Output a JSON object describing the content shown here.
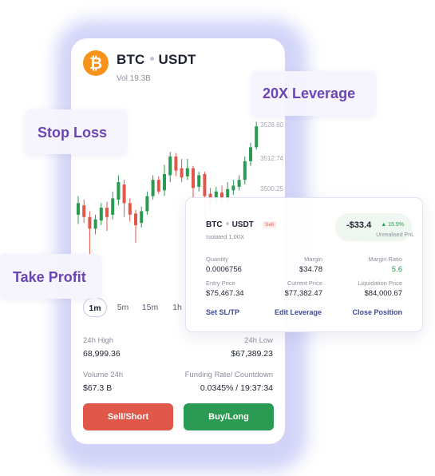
{
  "header": {
    "coin_symbol": "₿",
    "base": "BTC",
    "quote": "USDT",
    "volume": "Vol 19.3B"
  },
  "price_labels": [
    "3528.60",
    "3512.74",
    "3500.25"
  ],
  "timeframes": [
    "1m",
    "5m",
    "15m",
    "1h"
  ],
  "stats": {
    "high_label": "24h High",
    "high_value": "68,999.36",
    "low_label": "24h Low",
    "low_value": "$67,389.23",
    "volume_label": "Volume 24h",
    "volume_value": "$67.3 B",
    "funding_label": "Funding Rate/ Countdown",
    "funding_value": "0.0345% / 19:37:34"
  },
  "buttons": {
    "sell": "Sell/Short",
    "buy": "Buy/Long"
  },
  "tags": {
    "leverage": "20X Leverage",
    "stop_loss": "Stop Loss",
    "take_profit": "Take Profit"
  },
  "position": {
    "base": "BTC",
    "quote": "USDT",
    "side": "Sell",
    "mode": "Isolated 1.00X",
    "pnl": "-$33.4",
    "pnl_pct": "▲ 15.9%",
    "pnl_label": "Unrealised PnL",
    "quantity_label": "Quantity",
    "quantity_value": "0.0006756",
    "margin_label": "Margin",
    "margin_value": "$34.78",
    "margin_ratio_label": "Margin Ratio",
    "margin_ratio_value": "5.6",
    "entry_label": "Entry Price",
    "entry_value": "$75,467.34",
    "current_label": "Current Price",
    "current_value": "$77,382.47",
    "liq_label": "Liquidation Price",
    "liq_value": "$84,000.67",
    "action_sltp": "Set SL/TP",
    "action_leverage": "Edit Leverage",
    "action_close": "Close Position"
  },
  "colors": {
    "up": "#2b9a52",
    "down": "#e0584a",
    "accent": "#6b45b3",
    "coin": "#f7931a"
  },
  "chart_data": {
    "type": "candlestick",
    "y_range": [
      0,
      100
    ],
    "candles": [
      {
        "o": 42,
        "c": 52,
        "h": 58,
        "l": 34
      },
      {
        "o": 50,
        "c": 40,
        "h": 55,
        "l": 35
      },
      {
        "o": 40,
        "c": 30,
        "h": 45,
        "l": 8
      },
      {
        "o": 30,
        "c": 38,
        "h": 42,
        "l": 25
      },
      {
        "o": 37,
        "c": 48,
        "h": 52,
        "l": 33
      },
      {
        "o": 48,
        "c": 40,
        "h": 53,
        "l": 28
      },
      {
        "o": 42,
        "c": 56,
        "h": 62,
        "l": 38
      },
      {
        "o": 55,
        "c": 70,
        "h": 76,
        "l": 50
      },
      {
        "o": 68,
        "c": 52,
        "h": 72,
        "l": 40
      },
      {
        "o": 52,
        "c": 42,
        "h": 56,
        "l": 36
      },
      {
        "o": 43,
        "c": 33,
        "h": 46,
        "l": 18
      },
      {
        "o": 35,
        "c": 45,
        "h": 49,
        "l": 31
      },
      {
        "o": 45,
        "c": 58,
        "h": 62,
        "l": 42
      },
      {
        "o": 58,
        "c": 72,
        "h": 76,
        "l": 55
      },
      {
        "o": 72,
        "c": 62,
        "h": 75,
        "l": 60
      },
      {
        "o": 63,
        "c": 77,
        "h": 85,
        "l": 58
      },
      {
        "o": 76,
        "c": 92,
        "h": 96,
        "l": 70
      },
      {
        "o": 92,
        "c": 80,
        "h": 95,
        "l": 75
      },
      {
        "o": 82,
        "c": 74,
        "h": 90,
        "l": 70
      },
      {
        "o": 75,
        "c": 82,
        "h": 90,
        "l": 72
      },
      {
        "o": 82,
        "c": 65,
        "h": 84,
        "l": 56
      },
      {
        "o": 66,
        "c": 76,
        "h": 79,
        "l": 62
      },
      {
        "o": 77,
        "c": 58,
        "h": 79,
        "l": 42
      },
      {
        "o": 60,
        "c": 53,
        "h": 65,
        "l": 48
      },
      {
        "o": 54,
        "c": 62,
        "h": 66,
        "l": 50
      },
      {
        "o": 61,
        "c": 55,
        "h": 67,
        "l": 52
      },
      {
        "o": 55,
        "c": 64,
        "h": 70,
        "l": 52
      },
      {
        "o": 63,
        "c": 67,
        "h": 72,
        "l": 59
      },
      {
        "o": 66,
        "c": 72,
        "h": 76,
        "l": 63
      },
      {
        "o": 72,
        "c": 88,
        "h": 92,
        "l": 68
      },
      {
        "o": 88,
        "c": 100,
        "h": 104,
        "l": 84
      },
      {
        "o": 100,
        "c": 118,
        "h": 122,
        "l": 98
      }
    ]
  }
}
